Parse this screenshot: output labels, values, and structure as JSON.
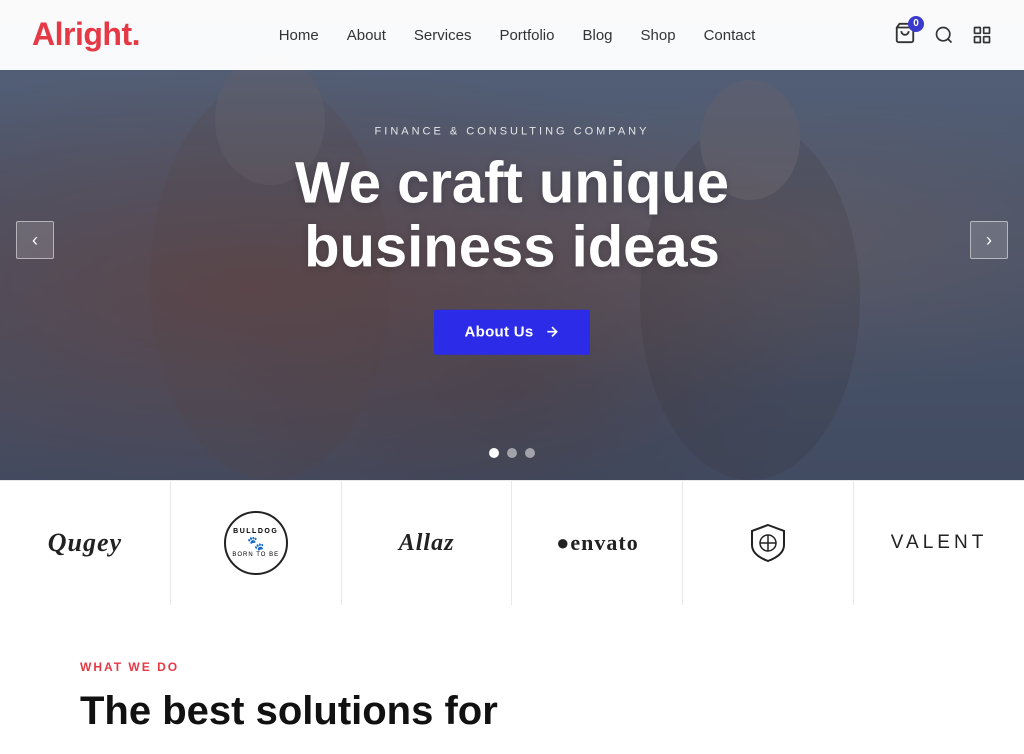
{
  "logo": {
    "text": "Alright",
    "dot": "."
  },
  "nav": {
    "items": [
      {
        "label": "Home",
        "id": "home"
      },
      {
        "label": "About",
        "id": "about"
      },
      {
        "label": "Services",
        "id": "services"
      },
      {
        "label": "Portfolio",
        "id": "portfolio"
      },
      {
        "label": "Blog",
        "id": "blog"
      },
      {
        "label": "Shop",
        "id": "shop"
      },
      {
        "label": "Contact",
        "id": "contact"
      }
    ]
  },
  "cart": {
    "count": "0"
  },
  "hero": {
    "subtitle": "Finance & Consulting Company",
    "title_line1": "We craft unique",
    "title_line2": "business ideas",
    "cta_label": "About Us",
    "arrow_left": "‹",
    "arrow_right": "›",
    "dots": [
      {
        "active": true
      },
      {
        "active": false
      },
      {
        "active": false
      }
    ]
  },
  "logos": [
    {
      "id": "qugey",
      "text": "Qugey",
      "style": "sans"
    },
    {
      "id": "bulldog",
      "text": "BULLDOG",
      "style": "circle"
    },
    {
      "id": "allaz",
      "text": "Allaz",
      "style": "serif"
    },
    {
      "id": "envato",
      "text": "●envato",
      "style": "sans"
    },
    {
      "id": "shield",
      "text": "◇",
      "style": "icon"
    },
    {
      "id": "valent",
      "text": "VALENT",
      "style": "wide"
    }
  ],
  "what_section": {
    "tag": "WHAT WE DO",
    "title_line1": "The best solutions for"
  }
}
